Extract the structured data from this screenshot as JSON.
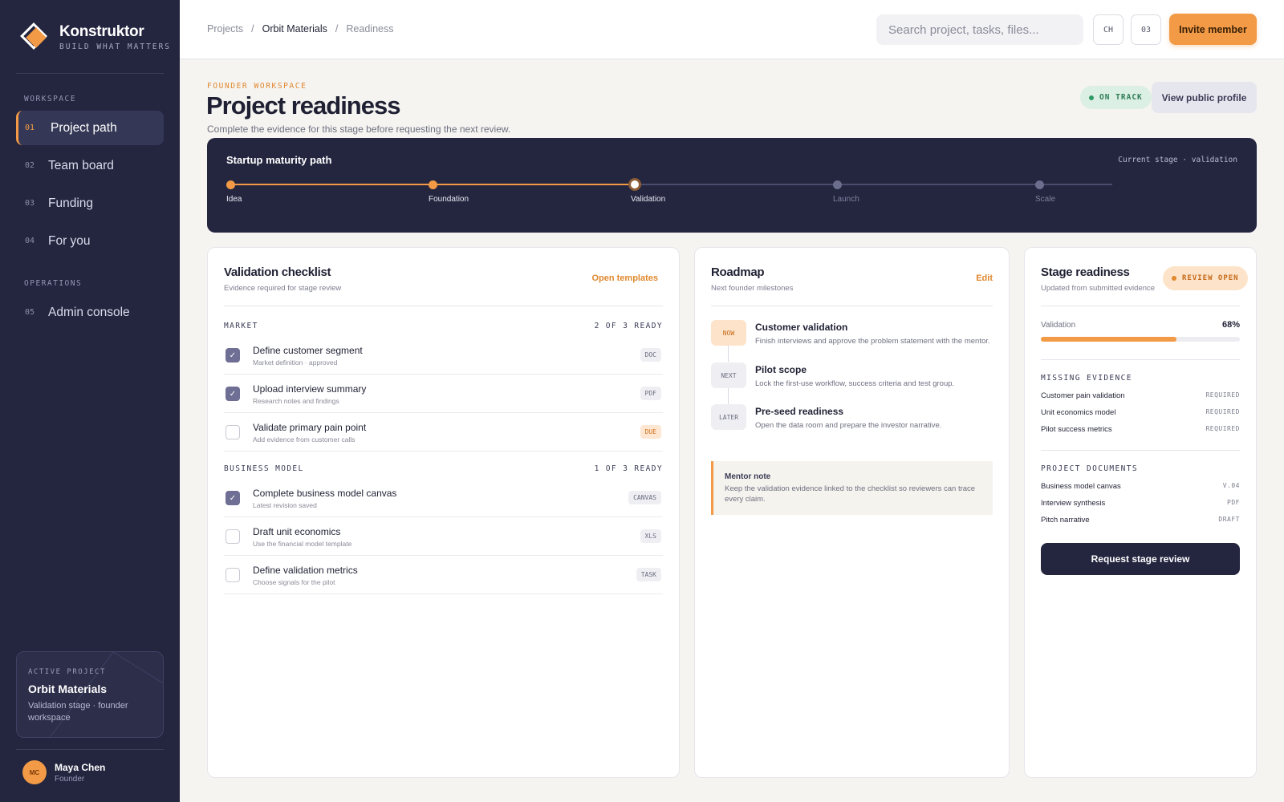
{
  "brand": {
    "name": "Konstruktor",
    "tagline": "BUILD WHAT MATTERS",
    "icon": "konstruktor-logo"
  },
  "sidebar": {
    "section_workspace": "WORKSPACE",
    "section_operations": "OPERATIONS",
    "items": [
      {
        "num": "01",
        "label": "Project path",
        "active": true
      },
      {
        "num": "02",
        "label": "Team board"
      },
      {
        "num": "03",
        "label": "Funding"
      },
      {
        "num": "04",
        "label": "For you"
      },
      {
        "num": "05",
        "label": "Admin console"
      }
    ],
    "active_project": {
      "label": "ACTIVE PROJECT",
      "name": "Orbit Materials",
      "desc": "Validation stage · founder workspace"
    },
    "user": {
      "initials": "MC",
      "name": "Maya Chen",
      "role": "Founder"
    }
  },
  "topbar": {
    "breadcrumb": [
      "Projects",
      "Orbit Materials",
      "Readiness"
    ],
    "search_placeholder": "Search project, tasks, files...",
    "lang": "CH",
    "count": "03",
    "invite_label": "Invite member"
  },
  "header": {
    "eyebrow": "FOUNDER WORKSPACE",
    "title": "Project readiness",
    "subtitle": "Complete the evidence for this stage before requesting the next review.",
    "status": "ON TRACK",
    "public_profile_label": "View public profile"
  },
  "maturity": {
    "title": "Startup maturity path",
    "current": "Current stage · validation",
    "stages": [
      "Idea",
      "Foundation",
      "Validation",
      "Launch",
      "Scale"
    ],
    "current_index": 2
  },
  "checklist": {
    "title": "Validation checklist",
    "subtitle": "Evidence required for stage review",
    "link": "Open templates",
    "groups": [
      {
        "name": "MARKET",
        "ready": "2 OF 3 READY",
        "tasks": [
          {
            "title": "Define customer segment",
            "sub": "Market definition · approved",
            "tag": "DOC",
            "checked": true
          },
          {
            "title": "Upload interview summary",
            "sub": "Research notes and findings",
            "tag": "PDF",
            "checked": true
          },
          {
            "title": "Validate primary pain point",
            "sub": "Add evidence from customer calls",
            "tag": "DUE",
            "checked": false
          }
        ]
      },
      {
        "name": "BUSINESS MODEL",
        "ready": "1 OF 3 READY",
        "tasks": [
          {
            "title": "Complete business model canvas",
            "sub": "Latest revision saved",
            "tag": "CANVAS",
            "checked": true
          },
          {
            "title": "Draft unit economics",
            "sub": "Use the financial model template",
            "tag": "XLS",
            "checked": false
          },
          {
            "title": "Define validation metrics",
            "sub": "Choose signals for the pilot",
            "tag": "TASK",
            "checked": false
          }
        ]
      }
    ]
  },
  "roadmap": {
    "title": "Roadmap",
    "subtitle": "Next founder milestones",
    "link": "Edit",
    "items": [
      {
        "badge": "NOW",
        "title": "Customer validation",
        "desc": "Finish interviews and approve the problem statement with the mentor."
      },
      {
        "badge": "NEXT",
        "title": "Pilot scope",
        "desc": "Lock the first-use workflow, success criteria and test group."
      },
      {
        "badge": "LATER",
        "title": "Pre-seed readiness",
        "desc": "Open the data room and prepare the investor narrative."
      }
    ],
    "note": {
      "title": "Mentor note",
      "body": "Keep the validation evidence linked to the checklist so reviewers can trace every claim."
    }
  },
  "readiness": {
    "title": "Stage readiness",
    "subtitle": "Updated from submitted evidence",
    "status": "REVIEW OPEN",
    "progress_label": "Validation",
    "progress_text": "68%",
    "progress_value": 0.68,
    "missing_title": "MISSING EVIDENCE",
    "missing": [
      {
        "name": "Customer pain validation",
        "state": "REQUIRED"
      },
      {
        "name": "Unit economics model",
        "state": "REQUIRED"
      },
      {
        "name": "Pilot success metrics",
        "state": "REQUIRED"
      }
    ],
    "docs_title": "PROJECT DOCUMENTS",
    "docs": [
      {
        "name": "Business model canvas",
        "state": "V.04"
      },
      {
        "name": "Interview synthesis",
        "state": "PDF"
      },
      {
        "name": "Pitch narrative",
        "state": "DRAFT"
      }
    ],
    "request_label": "Request stage review"
  },
  "colors": {
    "accent": "#f29a45",
    "navy": "#242640",
    "success": "#2e9a63"
  }
}
